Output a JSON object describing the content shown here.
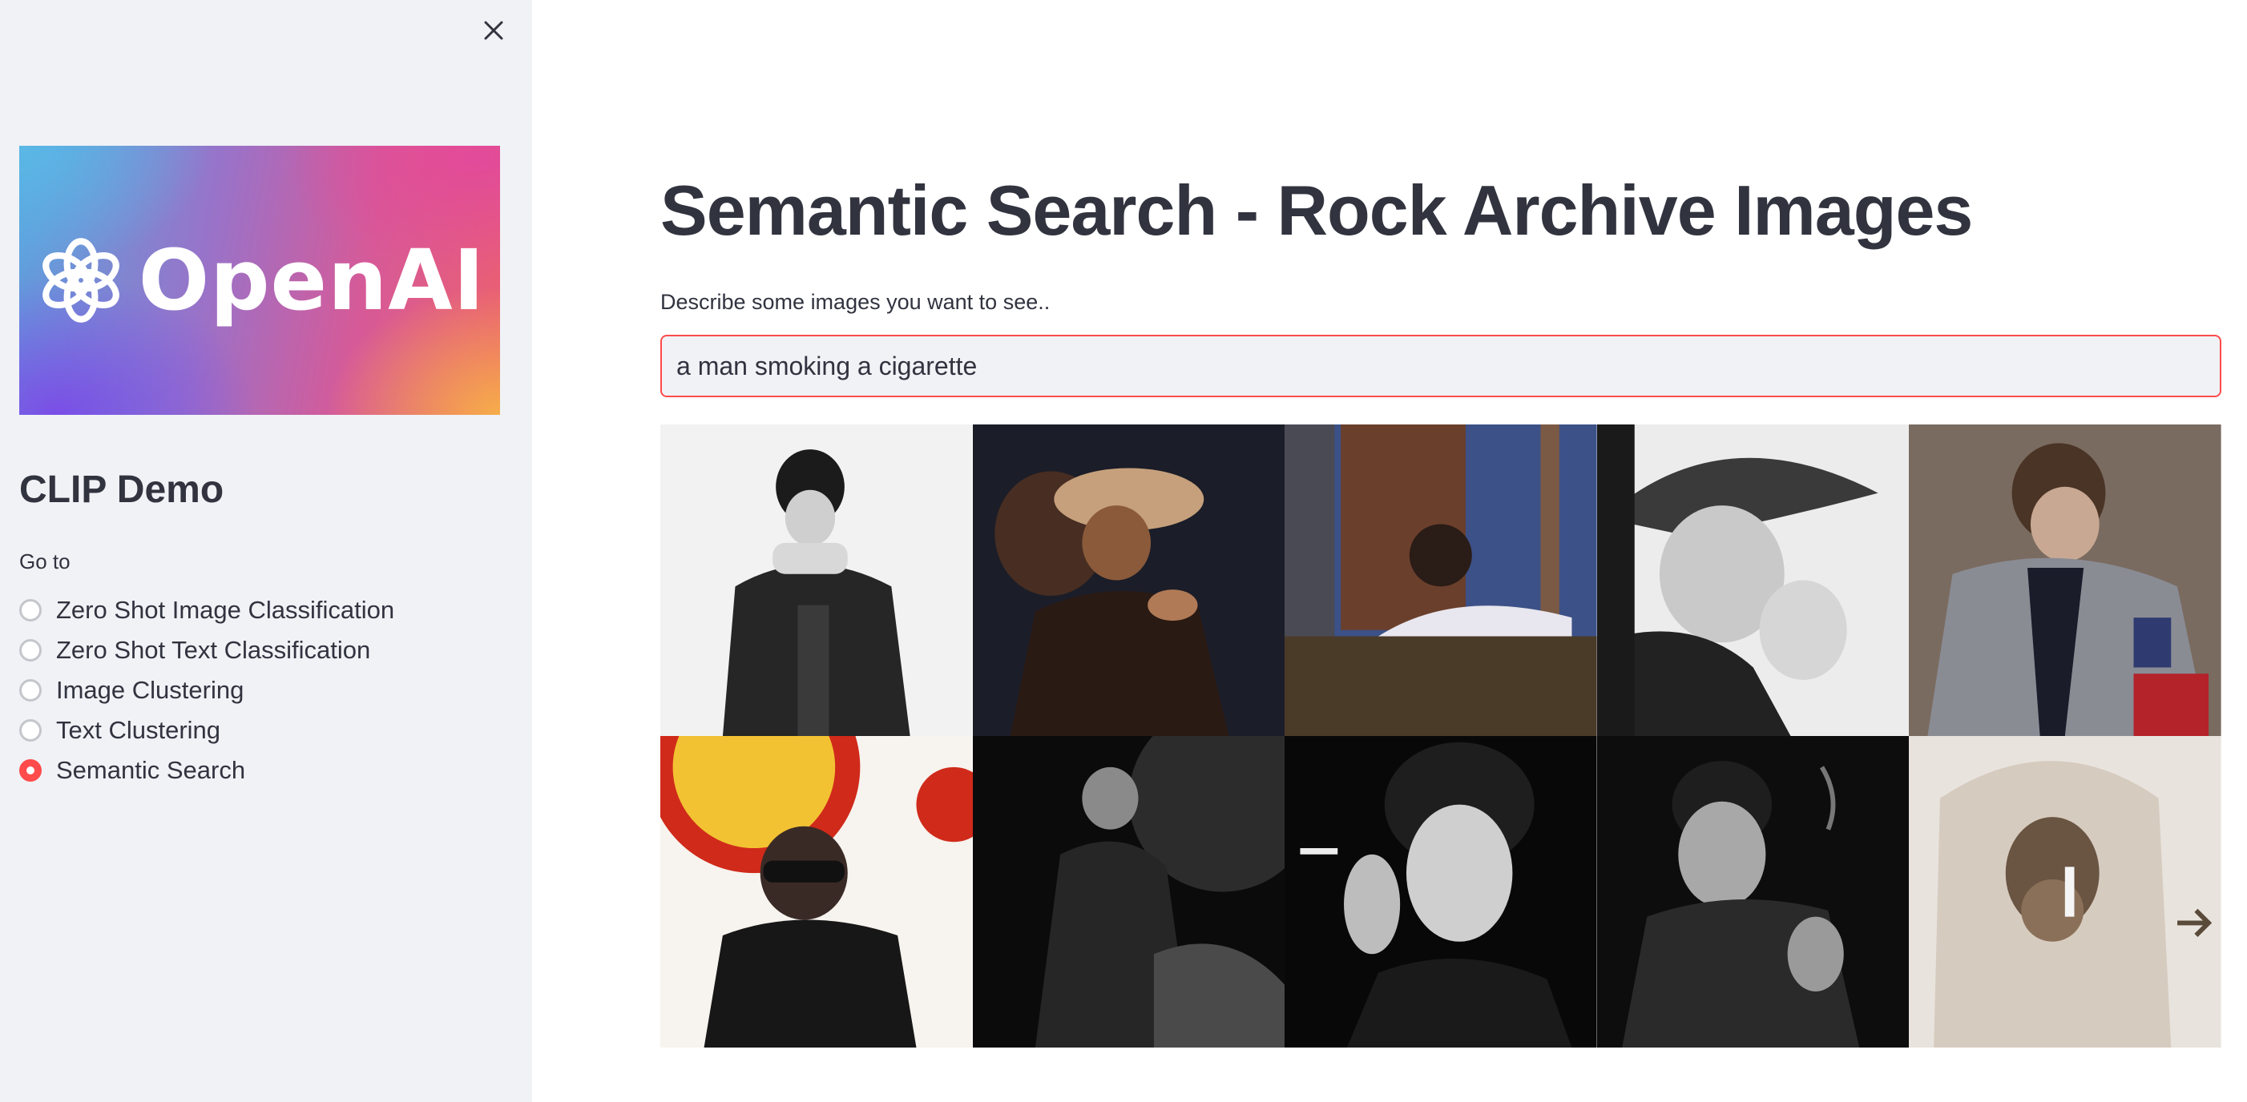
{
  "sidebar": {
    "close_icon": "close-icon",
    "logo": {
      "text": "OpenAI",
      "icon": "openai-logo-icon"
    },
    "title": "CLIP Demo",
    "nav_label": "Go to",
    "options": [
      {
        "label": "Zero Shot Image Classification",
        "selected": false
      },
      {
        "label": "Zero Shot Text Classification",
        "selected": false
      },
      {
        "label": "Image Clustering",
        "selected": false
      },
      {
        "label": "Text Clustering",
        "selected": false
      },
      {
        "label": "Semantic Search",
        "selected": true
      }
    ]
  },
  "main": {
    "title": "Semantic Search - Rock Archive Images",
    "input_label": "Describe some images you want to see..",
    "search_value": "a man smoking a cigarette",
    "results": [
      {
        "name": "result-image-1",
        "palette": [
          "#f4f4f4",
          "#1e1e1e",
          "#888888"
        ]
      },
      {
        "name": "result-image-2",
        "palette": [
          "#1a1c26",
          "#4a2a1e",
          "#c9a27c"
        ]
      },
      {
        "name": "result-image-3",
        "palette": [
          "#3b4f84",
          "#5a3a2a",
          "#e8e6ea"
        ]
      },
      {
        "name": "result-image-4",
        "palette": [
          "#e6e6e6",
          "#2a2a2a",
          "#9a9a9a"
        ]
      },
      {
        "name": "result-image-5",
        "palette": [
          "#7a6a5e",
          "#8a8c92",
          "#2f3a66"
        ]
      },
      {
        "name": "result-image-6",
        "palette": [
          "#f7f3ee",
          "#d22a1a",
          "#1b1b1b"
        ]
      },
      {
        "name": "result-image-7",
        "palette": [
          "#0c0c0c",
          "#555555",
          "#202020"
        ]
      },
      {
        "name": "result-image-8",
        "palette": [
          "#0a0a0a",
          "#9a9a9a",
          "#d8d8d8"
        ]
      },
      {
        "name": "result-image-9",
        "palette": [
          "#0e0e0e",
          "#6a6a6a",
          "#bdbdbd"
        ]
      },
      {
        "name": "result-image-10",
        "palette": [
          "#e9e4de",
          "#6b5a48",
          "#2a2420"
        ]
      }
    ],
    "accent": "#ff4b4b"
  }
}
